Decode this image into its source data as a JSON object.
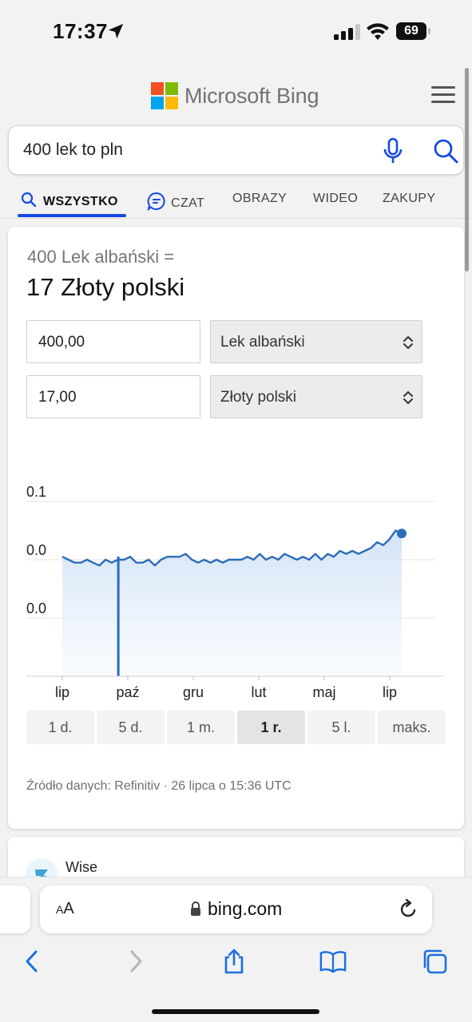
{
  "status_bar": {
    "time": "17:37",
    "battery": "69"
  },
  "header": {
    "brand": "Microsoft Bing"
  },
  "search": {
    "query": "400 lek to pln"
  },
  "tabs": [
    {
      "label": "WSZYSTKO",
      "active": true
    },
    {
      "label": "CZAT"
    },
    {
      "label": "OBRAZY"
    },
    {
      "label": "WIDEO"
    },
    {
      "label": "ZAKUPY"
    }
  ],
  "converter": {
    "from_line": "400 Lek albański =",
    "to_line": "17 Złoty polski",
    "amount_from": "400,00",
    "currency_from": "Lek albański",
    "amount_to": "17,00",
    "currency_to": "Złoty polski"
  },
  "chart_data": {
    "type": "line",
    "y_ticks": [
      "0.1",
      "0.0",
      "0.0"
    ],
    "x_ticks": [
      "lip",
      "paź",
      "gru",
      "lut",
      "maj",
      "lip"
    ],
    "fill": "area",
    "line_color": "#2b6cb8",
    "series": [
      {
        "values": [
          0.0425,
          0.0424,
          0.0423,
          0.0423,
          0.0424,
          0.0423,
          0.0422,
          0.0424,
          0.0423,
          0.0424,
          0.0424,
          0.0425,
          0.0423,
          0.0423,
          0.0424,
          0.0422,
          0.0424,
          0.0425,
          0.0425,
          0.0425,
          0.0426,
          0.0424,
          0.0423,
          0.0424,
          0.0423,
          0.0424,
          0.0423,
          0.0424,
          0.0424,
          0.0424,
          0.0425,
          0.0424,
          0.0426,
          0.0424,
          0.0425,
          0.0424,
          0.0426,
          0.0425,
          0.0424,
          0.0425,
          0.0424,
          0.0426,
          0.0424,
          0.0426,
          0.0425,
          0.0427,
          0.0426,
          0.0427,
          0.0426,
          0.0427,
          0.0428,
          0.043,
          0.0429,
          0.0431,
          0.0434,
          0.0433
        ]
      }
    ]
  },
  "range_buttons": [
    {
      "label": "1 d."
    },
    {
      "label": "5 d."
    },
    {
      "label": "1 m."
    },
    {
      "label": "1 r.",
      "active": true
    },
    {
      "label": "5 l."
    },
    {
      "label": "maks."
    }
  ],
  "source": "Źródło danych: Refinitiv · 26 lipca o 15:36 UTC",
  "next_result": {
    "title": "Wise"
  },
  "safari": {
    "aa_small": "A",
    "aa_large": "A",
    "url": "bing.com"
  },
  "colors": {
    "accent": "#174ae4",
    "chart_line": "#2b6cb8",
    "chart_fill": "#dce9f8"
  }
}
